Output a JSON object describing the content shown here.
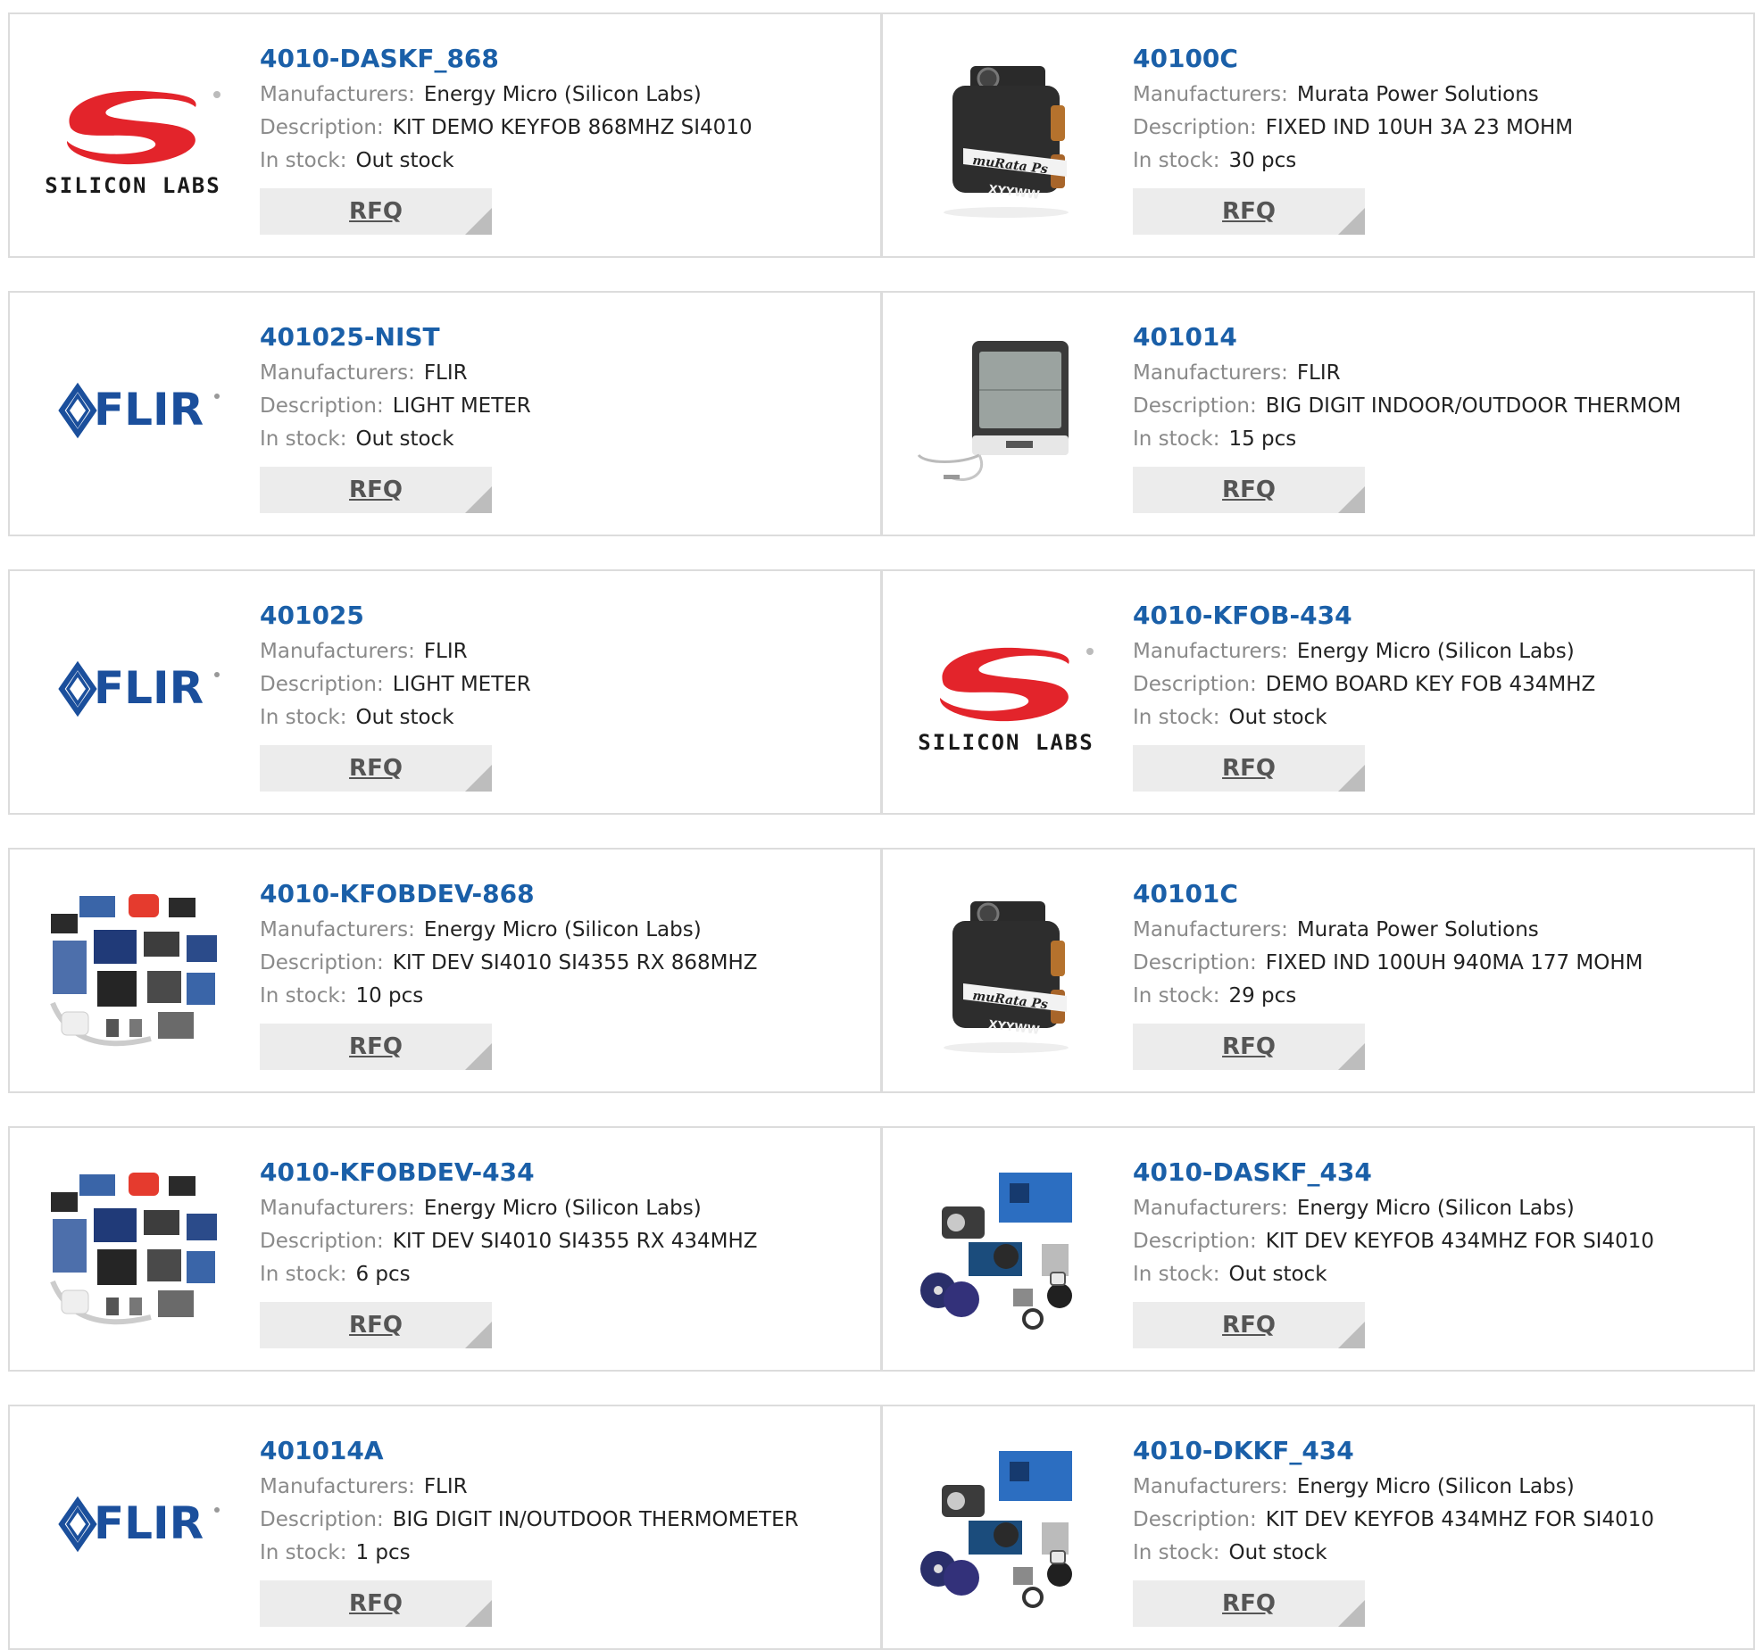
{
  "labels": {
    "manufacturers": "Manufacturers:",
    "description": "Description:",
    "stock": "In stock:",
    "rfq": "RFQ"
  },
  "colors": {
    "link": "#1a5fa8",
    "label": "#8a8a8a",
    "button_bg": "#ececec",
    "silabs_red": "#e3242b",
    "flir_blue": "#1b4f9c"
  },
  "rows": [
    [
      {
        "pn": "4010-DASKF_868",
        "mfr": "Energy Micro (Silicon Labs)",
        "desc": "KIT DEMO KEYFOB 868MHZ SI4010",
        "stock": "Out stock",
        "thumb": "silicon-labs-logo",
        "logo_text": "SILICON LABS"
      },
      {
        "pn": "40100C",
        "mfr": "Murata Power Solutions",
        "desc": "FIXED IND 10UH 3A 23 MOHM",
        "stock": "30 pcs",
        "thumb": "murata-inductor-photo",
        "logo_text": "XYYWW"
      }
    ],
    [
      {
        "pn": "401025-NIST",
        "mfr": "FLIR",
        "desc": "LIGHT METER",
        "stock": "Out stock",
        "thumb": "flir-logo",
        "logo_text": "FLIR"
      },
      {
        "pn": "401014",
        "mfr": "FLIR",
        "desc": "BIG DIGIT INDOOR/OUTDOOR THERMOM",
        "stock": "15 pcs",
        "thumb": "thermometer-photo",
        "logo_text": ""
      }
    ],
    [
      {
        "pn": "401025",
        "mfr": "FLIR",
        "desc": "LIGHT METER",
        "stock": "Out stock",
        "thumb": "flir-logo",
        "logo_text": "FLIR"
      },
      {
        "pn": "4010-KFOB-434",
        "mfr": "Energy Micro (Silicon Labs)",
        "desc": "DEMO BOARD KEY FOB 434MHZ",
        "stock": "Out stock",
        "thumb": "silicon-labs-logo",
        "logo_text": "SILICON LABS"
      }
    ],
    [
      {
        "pn": "4010-KFOBDEV-868",
        "mfr": "Energy Micro (Silicon Labs)",
        "desc": "KIT DEV SI4010 SI4355 RX 868MHZ",
        "stock": "10 pcs",
        "thumb": "dev-kit-photo",
        "logo_text": ""
      },
      {
        "pn": "40101C",
        "mfr": "Murata Power Solutions",
        "desc": "FIXED IND 100UH 940MA 177 MOHM",
        "stock": "29 pcs",
        "thumb": "murata-inductor-photo",
        "logo_text": "XYYWW"
      }
    ],
    [
      {
        "pn": "4010-KFOBDEV-434",
        "mfr": "Energy Micro (Silicon Labs)",
        "desc": "KIT DEV SI4010 SI4355 RX 434MHZ",
        "stock": "6 pcs",
        "thumb": "dev-kit-photo",
        "logo_text": ""
      },
      {
        "pn": "4010-DASKF_434",
        "mfr": "Energy Micro (Silicon Labs)",
        "desc": "KIT DEV KEYFOB 434MHZ FOR SI4010",
        "stock": "Out stock",
        "thumb": "keyfob-kit-photo",
        "logo_text": ""
      }
    ],
    [
      {
        "pn": "401014A",
        "mfr": "FLIR",
        "desc": "BIG DIGIT IN/OUTDOOR THERMOMETER",
        "stock": "1 pcs",
        "thumb": "flir-logo",
        "logo_text": "FLIR"
      },
      {
        "pn": "4010-DKKF_434",
        "mfr": "Energy Micro (Silicon Labs)",
        "desc": "KIT DEV KEYFOB 434MHZ FOR SI4010",
        "stock": "Out stock",
        "thumb": "keyfob-kit-photo",
        "logo_text": ""
      }
    ]
  ]
}
